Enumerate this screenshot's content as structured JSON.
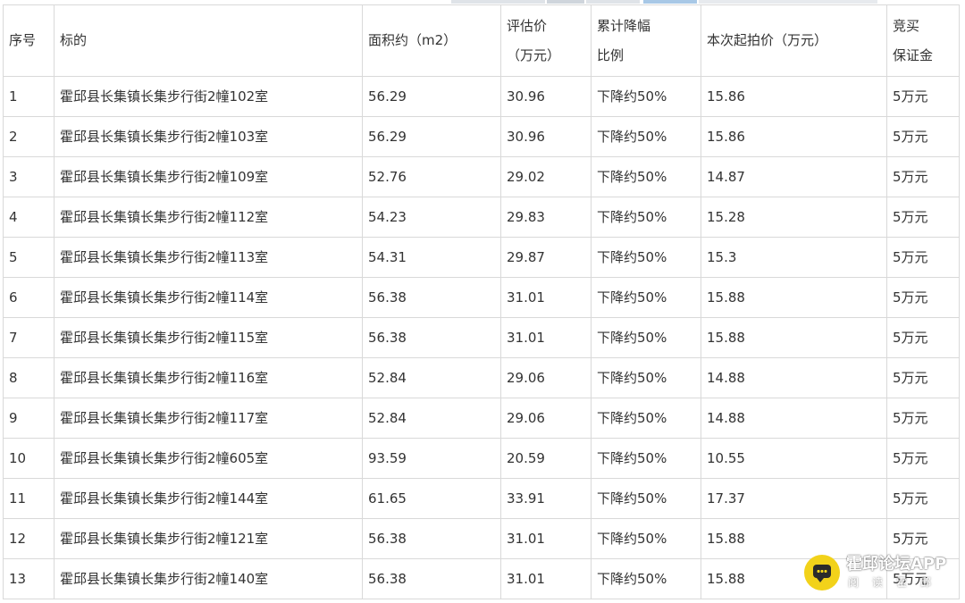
{
  "table": {
    "headers": {
      "col1": "序号",
      "col2": "标的",
      "col3": "面积约（m2）",
      "col4_line1": "评估价",
      "col4_line2": "（万元）",
      "col5_line1": "累计降幅",
      "col5_line2": "比例",
      "col6": "本次起拍价（万元）",
      "col7_line1": "竞买",
      "col7_line2": "保证金"
    },
    "rows": [
      {
        "no": "1",
        "item": "霍邱县长集镇长集步行街2幢102室",
        "area": "56.29",
        "valuation": "30.96",
        "reduction": "下降约50%",
        "start_price": "15.86",
        "deposit": "5万元"
      },
      {
        "no": "2",
        "item": "霍邱县长集镇长集步行街2幢103室",
        "area": "56.29",
        "valuation": "30.96",
        "reduction": "下降约50%",
        "start_price": "15.86",
        "deposit": "5万元"
      },
      {
        "no": "3",
        "item": "霍邱县长集镇长集步行街2幢109室",
        "area": "52.76",
        "valuation": "29.02",
        "reduction": "下降约50%",
        "start_price": "14.87",
        "deposit": "5万元"
      },
      {
        "no": "4",
        "item": "霍邱县长集镇长集步行街2幢112室",
        "area": "54.23",
        "valuation": "29.83",
        "reduction": "下降约50%",
        "start_price": "15.28",
        "deposit": "5万元"
      },
      {
        "no": "5",
        "item": "霍邱县长集镇长集步行街2幢113室",
        "area": "54.31",
        "valuation": "29.87",
        "reduction": "下降约50%",
        "start_price": "15.3",
        "deposit": "5万元"
      },
      {
        "no": "6",
        "item": "霍邱县长集镇长集步行街2幢114室",
        "area": "56.38",
        "valuation": "31.01",
        "reduction": "下降约50%",
        "start_price": "15.88",
        "deposit": "5万元"
      },
      {
        "no": "7",
        "item": "霍邱县长集镇长集步行街2幢115室",
        "area": "56.38",
        "valuation": "31.01",
        "reduction": "下降约50%",
        "start_price": "15.88",
        "deposit": "5万元"
      },
      {
        "no": "8",
        "item": "霍邱县长集镇长集步行街2幢116室",
        "area": "52.84",
        "valuation": "29.06",
        "reduction": "下降约50%",
        "start_price": "14.88",
        "deposit": "5万元"
      },
      {
        "no": "9",
        "item": "霍邱县长集镇长集步行街2幢117室",
        "area": "52.84",
        "valuation": "29.06",
        "reduction": "下降约50%",
        "start_price": "14.88",
        "deposit": "5万元"
      },
      {
        "no": "10",
        "item": "霍邱县长集镇长集步行街2幢605室",
        "area": "93.59",
        "valuation": "20.59",
        "reduction": "下降约50%",
        "start_price": "10.55",
        "deposit": "5万元"
      },
      {
        "no": "11",
        "item": "霍邱县长集镇长集步行街2幢144室",
        "area": "61.65",
        "valuation": "33.91",
        "reduction": "下降约50%",
        "start_price": "17.37",
        "deposit": "5万元"
      },
      {
        "no": "12",
        "item": "霍邱县长集镇长集步行街2幢121室",
        "area": "56.38",
        "valuation": "31.01",
        "reduction": "下降约50%",
        "start_price": "15.88",
        "deposit": "5万元"
      },
      {
        "no": "13",
        "item": "霍邱县长集镇长集步行街2幢140室",
        "area": "56.38",
        "valuation": "31.01",
        "reduction": "下降约50%",
        "start_price": "15.88",
        "deposit": "5万元"
      }
    ]
  },
  "watermark": {
    "title": "霍邱论坛APP",
    "subtitle": "阅读霍邱",
    "icon": "chat-bubble-icon",
    "icon_color": "#f2d21a"
  },
  "colors": {
    "border": "#d9d9d9",
    "text": "#333333"
  }
}
